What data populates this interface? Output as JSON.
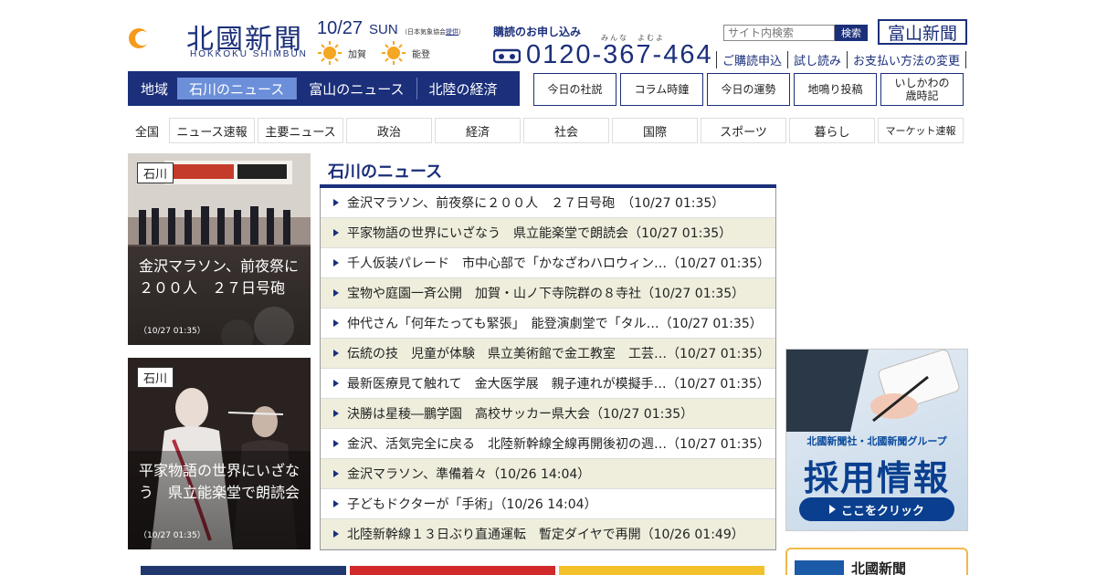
{
  "header": {
    "logo_jp": "北國新聞",
    "logo_en": "HOKKOKU SHIMBUN",
    "date": "10/27",
    "dow": "SUN",
    "weather_assoc": "（日本気象協会",
    "weather_assoc_link": "提供",
    "weather_assoc_end": "）",
    "weather": [
      {
        "area": "加賀",
        "icon": "sun-icon"
      },
      {
        "area": "能登",
        "icon": "sun-icon"
      }
    ],
    "subscribe_title": "購読のお申し込み",
    "phone_ruby": "みんな　よむよ",
    "phone": "0120-367-464",
    "search_placeholder": "サイト内検索",
    "search_button": "検索",
    "toyama_button": "富山新聞",
    "util_links": [
      "ご購読申込",
      "試し読み",
      "お支払い方法の変更"
    ]
  },
  "region_nav": {
    "label": "地域",
    "tabs": [
      {
        "label": "石川のニュース",
        "active": true
      },
      {
        "label": "富山のニュース",
        "active": false
      },
      {
        "label": "北陸の経済",
        "active": false
      }
    ]
  },
  "feature_buttons": [
    "今日の社説",
    "コラム時鐘",
    "今日の運勢",
    "地鳴り投稿",
    "いしかわの\n歳時記"
  ],
  "categories": [
    "全国",
    "ニュース速報",
    "主要ニュース",
    "政治",
    "経済",
    "社会",
    "国際",
    "スポーツ",
    "暮らし",
    "マーケット速報"
  ],
  "featured": [
    {
      "tag": "石川",
      "title": "金沢マラソン、前夜祭に２００人　２７日号砲",
      "time": "（10/27 01:35）"
    },
    {
      "tag": "石川",
      "title": "平家物語の世界にいざなう　県立能楽堂で朗読会",
      "time": "（10/27 01:35）"
    }
  ],
  "news": {
    "heading": "石川のニュース",
    "items": [
      "金沢マラソン、前夜祭に２００人　２７日号砲　（10/27 01:35）",
      "平家物語の世界にいざなう　県立能楽堂で朗読会（10/27 01:35）",
      "千人仮装パレード　市中心部で「かなざわハロウィン…（10/27 01:35）",
      "宝物や庭園一斉公開　加賀・山ノ下寺院群の８寺社（10/27 01:35）",
      "仲代さん「何年たっても緊張」　能登演劇堂で「タル…（10/27 01:35）",
      "伝統の技　児童が体験　県立美術館で金工教室　工芸…（10/27 01:35）",
      "最新医療見て触れて　金大医学展　親子連れが模擬手…（10/27 01:35）",
      "決勝は星稜―鵬学園　高校サッカー県大会（10/27 01:35）",
      "金沢、活気完全に戻る　北陸新幹線全線再開後初の週…（10/27 01:35）",
      "金沢マラソン、準備着々（10/26 14:04）",
      "子どもドクターが「手術」（10/26 14:04）",
      "北陸新幹線１３日ぶり直通運転　暫定ダイヤで再開（10/26 01:49）"
    ]
  },
  "ads": {
    "recruit_line1": "北國新聞社・北國新聞グループ",
    "recruit_line2": "採用情報",
    "recruit_button": "ここをクリック",
    "promo_title": "北國新聞"
  },
  "colors": {
    "brand_navy": "#1b2f7a",
    "active_tab": "#6c8fd9",
    "row_alt": "#efeedd",
    "sun": "#f5a623"
  }
}
